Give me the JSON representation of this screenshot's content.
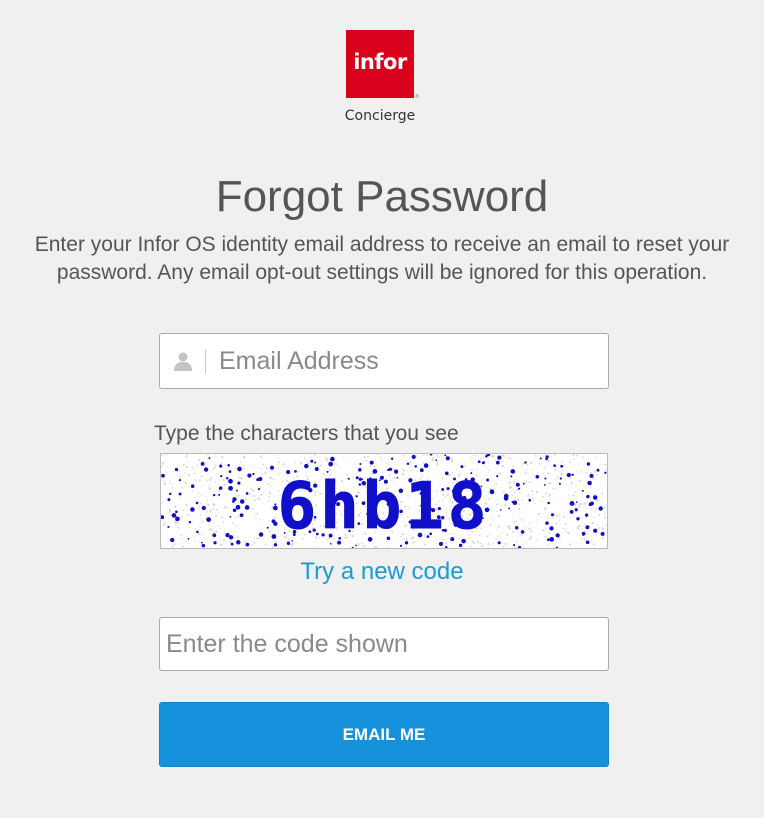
{
  "brand": {
    "logo_text": "infor",
    "logo_reg": "®",
    "subtitle": "Concierge",
    "accent_color": "#d9001b"
  },
  "page": {
    "title": "Forgot Password",
    "description": "Enter your Infor OS identity email address to receive an email to reset your password. Any email opt-out settings will be ignored for this operation."
  },
  "email_field": {
    "icon": "user-icon",
    "placeholder": "Email Address",
    "value": ""
  },
  "captcha": {
    "label": "Type the characters that you see",
    "code": "6hb18",
    "code_color": "#1010c8",
    "new_code_link": "Try a new code",
    "link_color": "#1a9ad7"
  },
  "code_field": {
    "placeholder": "Enter the code shown",
    "value": ""
  },
  "submit": {
    "label": "EMAIL ME",
    "color": "#1592db"
  }
}
